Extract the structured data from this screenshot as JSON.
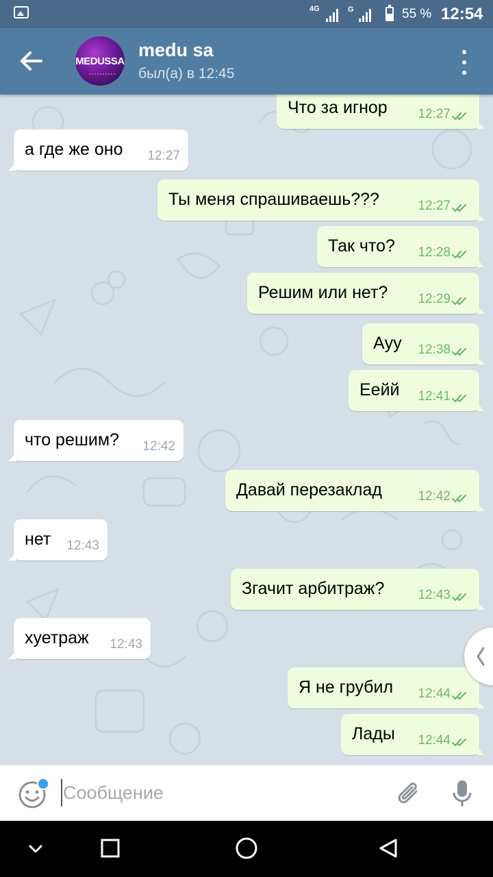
{
  "status_bar": {
    "network1": "4G",
    "network2": "G",
    "battery_text": "55 %",
    "time": "12:54",
    "icons": [
      "image-notification-icon",
      "signal-icon",
      "battery-icon"
    ]
  },
  "header": {
    "name": "medu sa",
    "status": "был(а) в 12:45",
    "avatar_text": "MEDUSSA",
    "icons": [
      "back-arrow-icon",
      "more-vert-icon"
    ]
  },
  "messages": [
    {
      "dir": "out",
      "text": "Что за игнор",
      "time": "12:27"
    },
    {
      "dir": "in",
      "text": "а где же оно",
      "time": "12:27"
    },
    {
      "dir": "out",
      "text": "Ты меня спрашиваешь???",
      "time": "12:27"
    },
    {
      "dir": "out",
      "text": "Так что?",
      "time": "12:28"
    },
    {
      "dir": "out",
      "text": "Решим или нет?",
      "time": "12:29"
    },
    {
      "dir": "out",
      "text": "Аyy",
      "time": "12:38"
    },
    {
      "dir": "out",
      "text": "Еейй",
      "time": "12:41"
    },
    {
      "dir": "in",
      "text": "что решим?",
      "time": "12:42"
    },
    {
      "dir": "out",
      "text": "Давай перезаклад",
      "time": "12:42"
    },
    {
      "dir": "in",
      "text": "нет",
      "time": "12:43"
    },
    {
      "dir": "out",
      "text": "Згачит арбитраж?",
      "time": "12:43"
    },
    {
      "dir": "in",
      "text": "хуетраж",
      "time": "12:43"
    },
    {
      "dir": "out",
      "text": "Я не грубил",
      "time": "12:44"
    },
    {
      "dir": "out",
      "text": "Лады",
      "time": "12:44"
    }
  ],
  "input": {
    "placeholder": "Сообщение",
    "icons": [
      "emoji-icon",
      "attach-icon",
      "mic-icon"
    ]
  },
  "colors": {
    "header_bg": "#527da3",
    "status_bg": "#4a6a8c",
    "incoming_bubble": "#ffffff",
    "outgoing_bubble": "#effdde",
    "read_check": "#6cb86a",
    "chat_bg": "#d6dfe7"
  }
}
